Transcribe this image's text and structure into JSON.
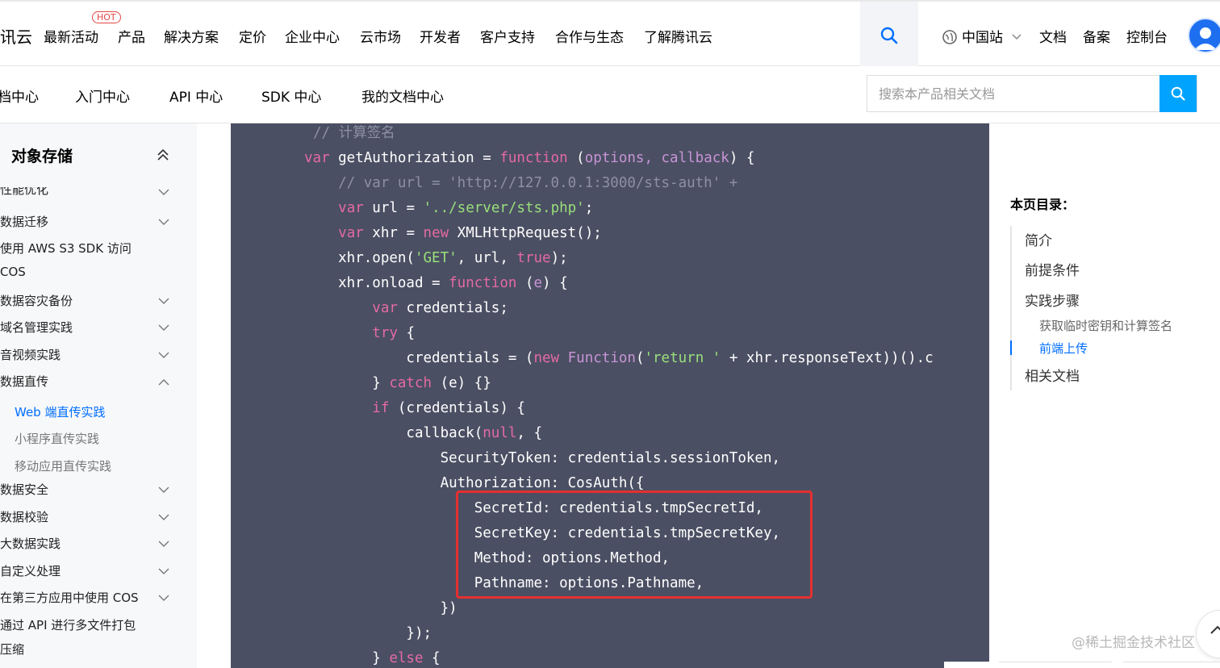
{
  "topnav": {
    "logo_fragment": "讯云",
    "hot_badge": "HOT",
    "items": [
      "最新活动",
      "产品",
      "解决方案",
      "定价",
      "企业中心",
      "云市场",
      "开发者",
      "客户支持",
      "合作与生态",
      "了解腾讯云"
    ],
    "site": "中国站",
    "links": [
      "文档",
      "备案",
      "控制台"
    ]
  },
  "subnav": {
    "tabs": [
      "文档中心",
      "入门中心",
      "API 中心",
      "SDK 中心",
      "我的文档中心"
    ],
    "search_placeholder": "搜索本产品相关文档"
  },
  "sidebar": {
    "title": "对象存储",
    "items": [
      {
        "label": "性能优化",
        "type": "group"
      },
      {
        "label": "数据迁移",
        "type": "group"
      },
      {
        "label": "使用 AWS S3 SDK 访问",
        "type": "plain"
      },
      {
        "label": "COS",
        "type": "plain"
      },
      {
        "label": "数据容灾备份",
        "type": "group"
      },
      {
        "label": "域名管理实践",
        "type": "group"
      },
      {
        "label": "音视频实践",
        "type": "group"
      },
      {
        "label": "数据直传",
        "type": "expanded"
      },
      {
        "label": "Web 端直传实践",
        "type": "sub-active"
      },
      {
        "label": "小程序直传实践",
        "type": "sub"
      },
      {
        "label": "移动应用直传实践",
        "type": "sub"
      },
      {
        "label": "数据安全",
        "type": "group"
      },
      {
        "label": "数据校验",
        "type": "group"
      },
      {
        "label": "大数据实践",
        "type": "group"
      },
      {
        "label": "自定义处理",
        "type": "group"
      },
      {
        "label": "在第三方应用中使用 COS",
        "type": "group"
      },
      {
        "label": "通过 API 进行多文件打包",
        "type": "plain"
      },
      {
        "label": "压缩",
        "type": "plain"
      }
    ]
  },
  "code": {
    "lines": [
      [
        {
          "t": "// 计算签名",
          "c": "cm"
        }
      ],
      [
        {
          "t": "var",
          "c": "kw"
        },
        {
          "t": " getAuthorization = "
        },
        {
          "t": "function",
          "c": "kw"
        },
        {
          "t": " ("
        },
        {
          "t": "options, callback",
          "c": "pm"
        },
        {
          "t": ") {"
        }
      ],
      [
        {
          "t": "    // var url = 'http://127.0.0.1:3000/sts-auth' +",
          "c": "cm"
        }
      ],
      [
        {
          "t": "    "
        },
        {
          "t": "var",
          "c": "kw"
        },
        {
          "t": " url = "
        },
        {
          "t": "'../server/sts.php'",
          "c": "str"
        },
        {
          "t": ";"
        }
      ],
      [
        {
          "t": "    "
        },
        {
          "t": "var",
          "c": "kw"
        },
        {
          "t": " xhr = "
        },
        {
          "t": "new",
          "c": "kw"
        },
        {
          "t": " XMLHttpRequest();"
        }
      ],
      [
        {
          "t": "    xhr.open("
        },
        {
          "t": "'GET'",
          "c": "str"
        },
        {
          "t": ", url, "
        },
        {
          "t": "true",
          "c": "kw"
        },
        {
          "t": ");"
        }
      ],
      [
        {
          "t": "    xhr.onload = "
        },
        {
          "t": "function",
          "c": "kw"
        },
        {
          "t": " ("
        },
        {
          "t": "e",
          "c": "pm"
        },
        {
          "t": ") {"
        }
      ],
      [
        {
          "t": "        "
        },
        {
          "t": "var",
          "c": "kw"
        },
        {
          "t": " credentials;"
        }
      ],
      [
        {
          "t": "        "
        },
        {
          "t": "try",
          "c": "kw"
        },
        {
          "t": " {"
        }
      ],
      [
        {
          "t": "            credentials = ("
        },
        {
          "t": "new",
          "c": "kw"
        },
        {
          "t": " "
        },
        {
          "t": "Function",
          "c": "pm"
        },
        {
          "t": "("
        },
        {
          "t": "'return '",
          "c": "str"
        },
        {
          "t": " + xhr.responseText))().c"
        }
      ],
      [
        {
          "t": "        } "
        },
        {
          "t": "catch",
          "c": "kw"
        },
        {
          "t": " (e) {}"
        }
      ],
      [
        {
          "t": "        "
        },
        {
          "t": "if",
          "c": "kw"
        },
        {
          "t": " (credentials) {"
        }
      ],
      [
        {
          "t": "            callback("
        },
        {
          "t": "null",
          "c": "kw"
        },
        {
          "t": ", {"
        }
      ],
      [
        {
          "t": "                SecurityToken: credentials.sessionToken,"
        }
      ],
      [
        {
          "t": "                Authorization: CosAuth({"
        }
      ],
      [
        {
          "t": "                    SecretId: credentials.tmpSecretId,"
        }
      ],
      [
        {
          "t": "                    SecretKey: credentials.tmpSecretKey,"
        }
      ],
      [
        {
          "t": "                    Method: options.Method,"
        }
      ],
      [
        {
          "t": "                    Pathname: options.Pathname,"
        }
      ],
      [
        {
          "t": "                })"
        }
      ],
      [
        {
          "t": "            });"
        }
      ],
      [
        {
          "t": "        } "
        },
        {
          "t": "else",
          "c": "kw"
        },
        {
          "t": " {"
        }
      ]
    ]
  },
  "toc": {
    "heading": "本页目录：",
    "items": [
      {
        "label": "简介",
        "type": "main"
      },
      {
        "label": "前提条件",
        "type": "main"
      },
      {
        "label": "实践步骤",
        "type": "main"
      },
      {
        "label": "获取临时密钥和计算签名",
        "type": "sub"
      },
      {
        "label": "前端上传",
        "type": "sub-active"
      },
      {
        "label": "相关文档",
        "type": "main"
      }
    ]
  },
  "watermark": "@稀土掘金技术社区",
  "colors": {
    "accent": "#006eff",
    "code_bg": "#4b4f63",
    "highlight_box": "#e5302f",
    "search_button": "#00a4ff"
  }
}
